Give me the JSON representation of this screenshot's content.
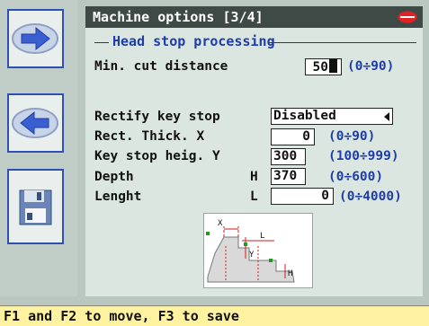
{
  "window": {
    "title": "Machine options [3/4]",
    "logo_icon": "silca-logo-icon"
  },
  "sidebar": {
    "buttons": [
      {
        "icon": "arrow-right-icon"
      },
      {
        "icon": "arrow-left-icon"
      },
      {
        "icon": "floppy-save-icon"
      }
    ]
  },
  "group": {
    "title": "Head stop processing"
  },
  "fields": {
    "min_cut": {
      "label": "Min. cut distance",
      "value": "50",
      "range": "(0÷90)"
    },
    "rectify": {
      "label": "Rectify key stop",
      "value": "Disabled"
    },
    "rect_thick": {
      "label": "Rect. Thick. X",
      "value": "0",
      "range": "(0÷90)"
    },
    "key_stop_heig": {
      "label": "Key stop heig. Y",
      "value": "300",
      "range": "(100÷999)"
    },
    "depth": {
      "label": "Depth",
      "axis": "H",
      "value": "370",
      "range": "(0÷600)"
    },
    "lenght": {
      "label": "Lenght",
      "axis": "L",
      "value": "0",
      "range": "(0÷4000)"
    }
  },
  "diagram": {
    "labels": {
      "x": "X",
      "y": "Y",
      "h": "H",
      "l": "L"
    }
  },
  "status": {
    "text": "F1 and F2 to move, F3 to save"
  },
  "colors": {
    "accent_blue": "#2f4fb3",
    "status_bg": "#fff3a2",
    "title_bg": "#3f4a46",
    "marker_red": "#d11b1b"
  }
}
